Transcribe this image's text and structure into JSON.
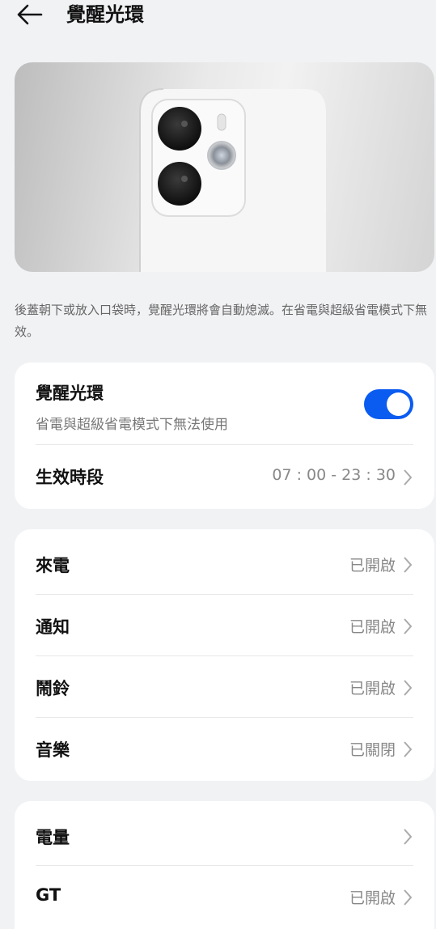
{
  "header": {
    "title": "覺醒光環"
  },
  "description": "後蓋朝下或放入口袋時，覺醒光環將會自動熄滅。在省電與超級省電模式下無效。",
  "main_card": {
    "toggle_title": "覺醒光環",
    "toggle_subtitle": "省電與超級省電模式下無法使用",
    "toggle_on": true,
    "schedule_label": "生效時段",
    "schedule_value": "07 : 00 - 23 : 30"
  },
  "notify_card": {
    "items": [
      {
        "label": "來電",
        "value": "已開啟"
      },
      {
        "label": "通知",
        "value": "已開啟"
      },
      {
        "label": "鬧鈴",
        "value": "已開啟"
      },
      {
        "label": "音樂",
        "value": "已關閉"
      }
    ]
  },
  "other_card": {
    "items": [
      {
        "label": "電量",
        "value": ""
      },
      {
        "label": "GT",
        "value": "已開啟"
      }
    ]
  },
  "colors": {
    "accent": "#0a5bf0",
    "background": "#f1f2f4",
    "card": "#ffffff"
  }
}
